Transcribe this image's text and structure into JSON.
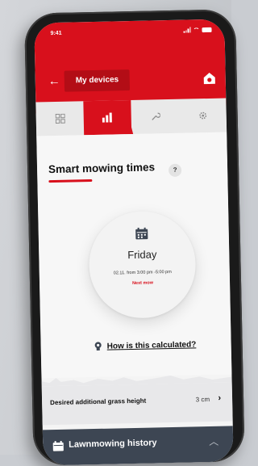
{
  "status": {
    "time": "9:41"
  },
  "header": {
    "title": "My devices"
  },
  "tabs": [
    {
      "name": "overview",
      "icon": "grid-icon"
    },
    {
      "name": "statistics",
      "icon": "bar-chart-icon",
      "active": true
    },
    {
      "name": "tools",
      "icon": "wrench-icon"
    },
    {
      "name": "settings",
      "icon": "gear-icon"
    }
  ],
  "section": {
    "title": "Smart mowing times",
    "help": "?"
  },
  "schedule": {
    "day": "Friday",
    "when": "02.11. from 3:00 pm -5:00 pm",
    "status": "Next mow"
  },
  "calc_link": "How is this calculated?",
  "grass": {
    "label": "Desired additional grass height",
    "value": "3 cm"
  },
  "history": {
    "label": "Lawnmowing history"
  },
  "colors": {
    "brand_red": "#d8101c",
    "dark_bar": "#3d4653"
  }
}
